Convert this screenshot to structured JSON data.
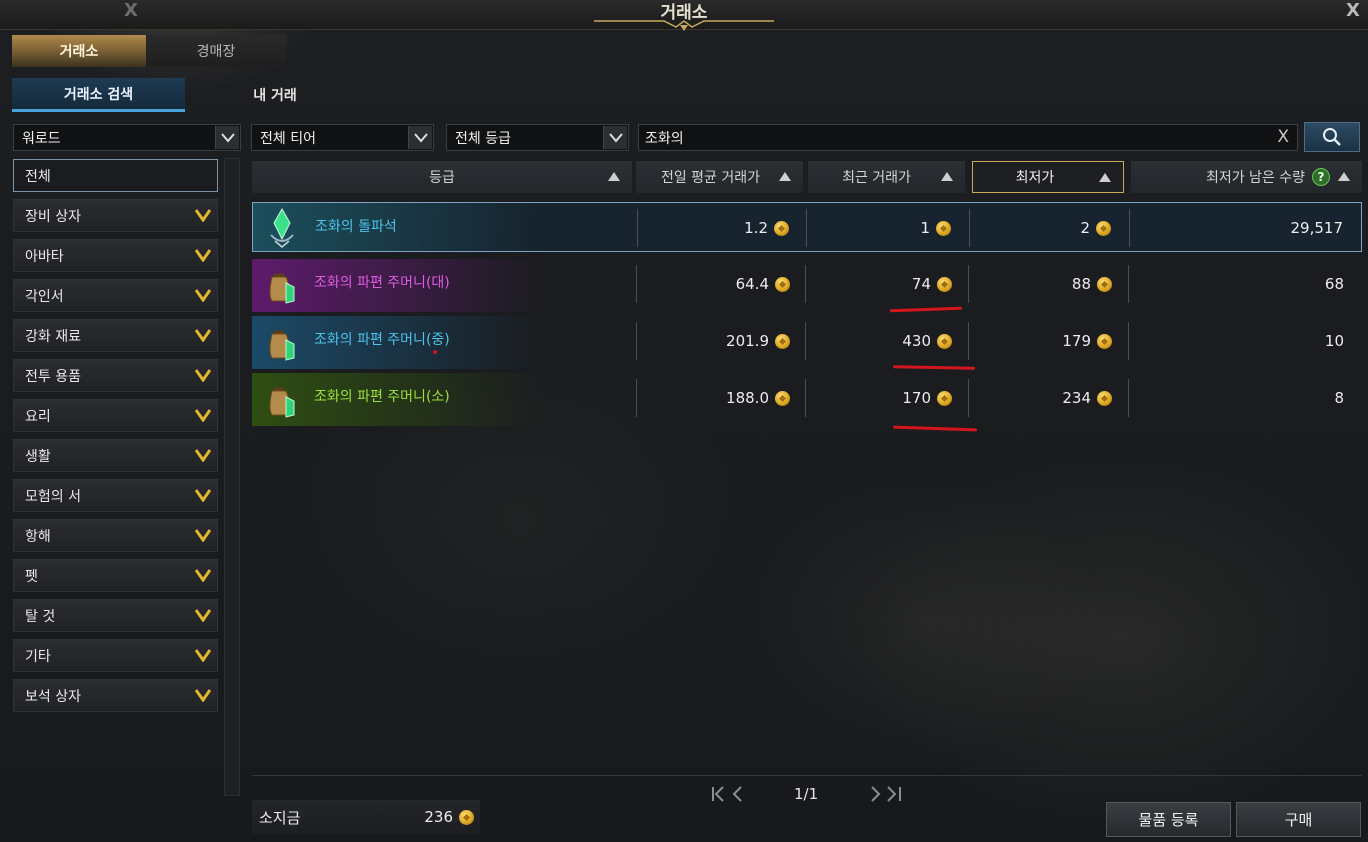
{
  "window": {
    "title": "거래소",
    "close_icon": "X"
  },
  "top_tabs": [
    "거래소",
    "경매장"
  ],
  "sub_tabs": [
    "거래소 검색",
    "내 거래"
  ],
  "filters": {
    "region": "워로드",
    "tier": "전체 티어",
    "grade": "전체 등급",
    "search_value": "조화의",
    "clear_label": "X"
  },
  "sidebar": {
    "items": [
      {
        "label": "전체",
        "active": true
      },
      {
        "label": "장비 상자"
      },
      {
        "label": "아바타"
      },
      {
        "label": "각인서"
      },
      {
        "label": "강화 재료"
      },
      {
        "label": "전투 용품"
      },
      {
        "label": "요리"
      },
      {
        "label": "생활"
      },
      {
        "label": "모험의 서"
      },
      {
        "label": "항해"
      },
      {
        "label": "펫"
      },
      {
        "label": "탈 것"
      },
      {
        "label": "기타"
      },
      {
        "label": "보석 상자"
      }
    ]
  },
  "table": {
    "headers": [
      "등급",
      "전일 평균 거래가",
      "최근 거래가",
      "최저가",
      "최저가 남은 수량"
    ],
    "sorted_header": "최저가",
    "help_badge": "?",
    "rows": [
      {
        "name": "조화의 돌파석",
        "avg": "1.2",
        "recent": "1",
        "lowest": "2",
        "qty": "29,517",
        "name_color": "#4fc3ea",
        "grade_color": "#1c4e5c"
      },
      {
        "name": "조화의 파편 주머니(대)",
        "avg": "64.4",
        "recent": "74",
        "lowest": "88",
        "qty": "68",
        "name_color": "#e05ce0",
        "grade_color": "#5e1b6c"
      },
      {
        "name": "조화의 파편 주머니(중)",
        "avg": "201.9",
        "recent": "430",
        "lowest": "179",
        "qty": "10",
        "name_color": "#4fc3ea",
        "grade_color": "#1b4a68"
      },
      {
        "name": "조화의 파편 주머니(소)",
        "avg": "188.0",
        "recent": "170",
        "lowest": "234",
        "qty": "8",
        "name_color": "#9be23c",
        "grade_color": "#2f4e12"
      }
    ]
  },
  "pager": {
    "current": "1/1",
    "first": "|<<",
    "prev": "<",
    "next": ">",
    "last": ">>|"
  },
  "footer": {
    "money_label": "소지금",
    "money_value": "236",
    "register_button": "물품 등록",
    "buy_button": "구매"
  }
}
